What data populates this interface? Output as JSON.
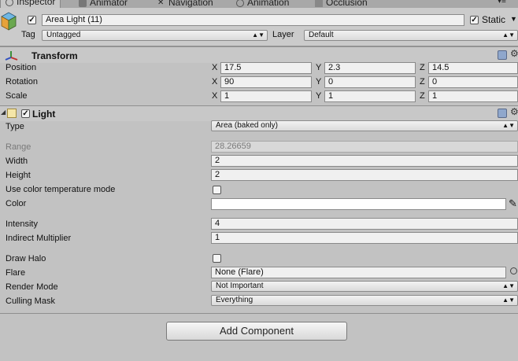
{
  "tabs": [
    {
      "label": "Inspector",
      "icon": "info-icon",
      "active": true
    },
    {
      "label": "Animator",
      "icon": "animator-icon",
      "active": false
    },
    {
      "label": "Navigation",
      "icon": "navigation-icon",
      "active": false
    },
    {
      "label": "Animation",
      "icon": "animation-icon",
      "active": false
    },
    {
      "label": "Occlusion",
      "icon": "occlusion-icon",
      "active": false
    }
  ],
  "tab_menu_glyph": "▾≡",
  "header": {
    "object_name": "Area Light (11)",
    "active": true,
    "static_label": "Static",
    "static": true,
    "tag_label": "Tag",
    "tag_value": "Untagged",
    "layer_label": "Layer",
    "layer_value": "Default"
  },
  "transform": {
    "title": "Transform",
    "rows": [
      {
        "label": "Position",
        "x": "17.5",
        "y": "2.3",
        "z": "14.5"
      },
      {
        "label": "Rotation",
        "x": "90",
        "y": "0",
        "z": "0"
      },
      {
        "label": "Scale",
        "x": "1",
        "y": "1",
        "z": "1"
      }
    ],
    "axis_labels": [
      "X",
      "Y",
      "Z"
    ]
  },
  "light": {
    "title": "Light",
    "enabled": true,
    "type_label": "Type",
    "type_value": "Area (baked only)",
    "range_label": "Range",
    "range_value": "28.26659",
    "width_label": "Width",
    "width_value": "2",
    "height_label": "Height",
    "height_value": "2",
    "color_temp_label": "Use color temperature mode",
    "color_temp": false,
    "color_label": "Color",
    "color_value": "#ffffff",
    "intensity_label": "Intensity",
    "intensity_value": "4",
    "indirect_label": "Indirect Multiplier",
    "indirect_value": "1",
    "draw_halo_label": "Draw Halo",
    "draw_halo": false,
    "flare_label": "Flare",
    "flare_value": "None (Flare)",
    "render_mode_label": "Render Mode",
    "render_mode_value": "Not Important",
    "culling_label": "Culling Mask",
    "culling_value": "Everything"
  },
  "add_component_label": "Add Component",
  "colors": {
    "panel_bg": "#c2c2c2",
    "field_bg": "#f0f0f0",
    "border": "#8a8a8a"
  }
}
